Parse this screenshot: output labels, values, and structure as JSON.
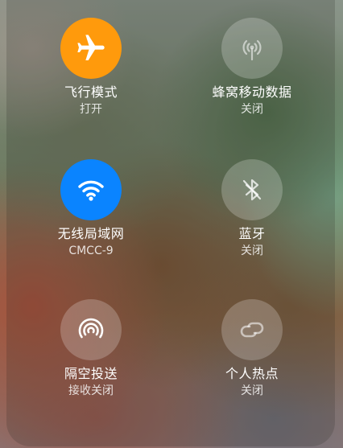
{
  "controls": [
    {
      "icon": "airplane-icon",
      "label": "飞行模式",
      "status": "打开",
      "state": "on",
      "color": "#ff9a0c"
    },
    {
      "icon": "cellular-icon",
      "label": "蜂窝移动数据",
      "status": "关闭",
      "state": "off"
    },
    {
      "icon": "wifi-icon",
      "label": "无线局域网",
      "status": "CMCC-9",
      "state": "on",
      "color": "#0a84ff"
    },
    {
      "icon": "bluetooth-icon",
      "label": "蓝牙",
      "status": "关闭",
      "state": "off"
    },
    {
      "icon": "airdrop-icon",
      "label": "隔空投送",
      "status": "接收关闭",
      "state": "off"
    },
    {
      "icon": "hotspot-icon",
      "label": "个人热点",
      "status": "关闭",
      "state": "off"
    }
  ]
}
